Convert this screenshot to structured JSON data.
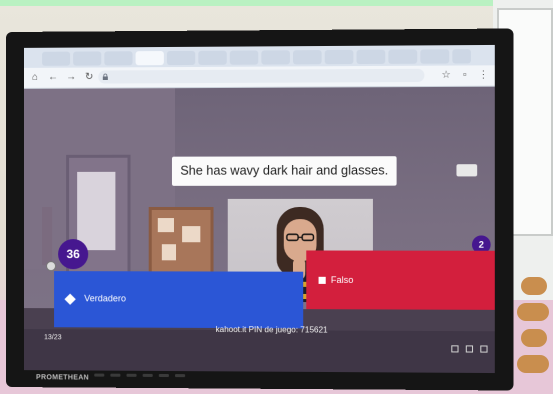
{
  "browser": {
    "tabs": [
      "",
      "",
      "",
      "",
      "",
      "",
      "",
      "",
      "",
      "",
      "",
      "",
      "",
      "",
      ""
    ],
    "url": ""
  },
  "quiz": {
    "question": "She has wavy dark hair and glasses.",
    "timer": "36",
    "answers_count": "2",
    "answer_true": "Verdadero",
    "answer_false": "Falso",
    "question_counter": "13/23",
    "pin_text": "kahoot.it PIN de juego: 715621"
  },
  "monitor": {
    "brand": "PROMETHEAN"
  },
  "colors": {
    "kahoot_purple": "#46178f",
    "true_blue": "#2b56d6",
    "false_red": "#d31f3d"
  }
}
